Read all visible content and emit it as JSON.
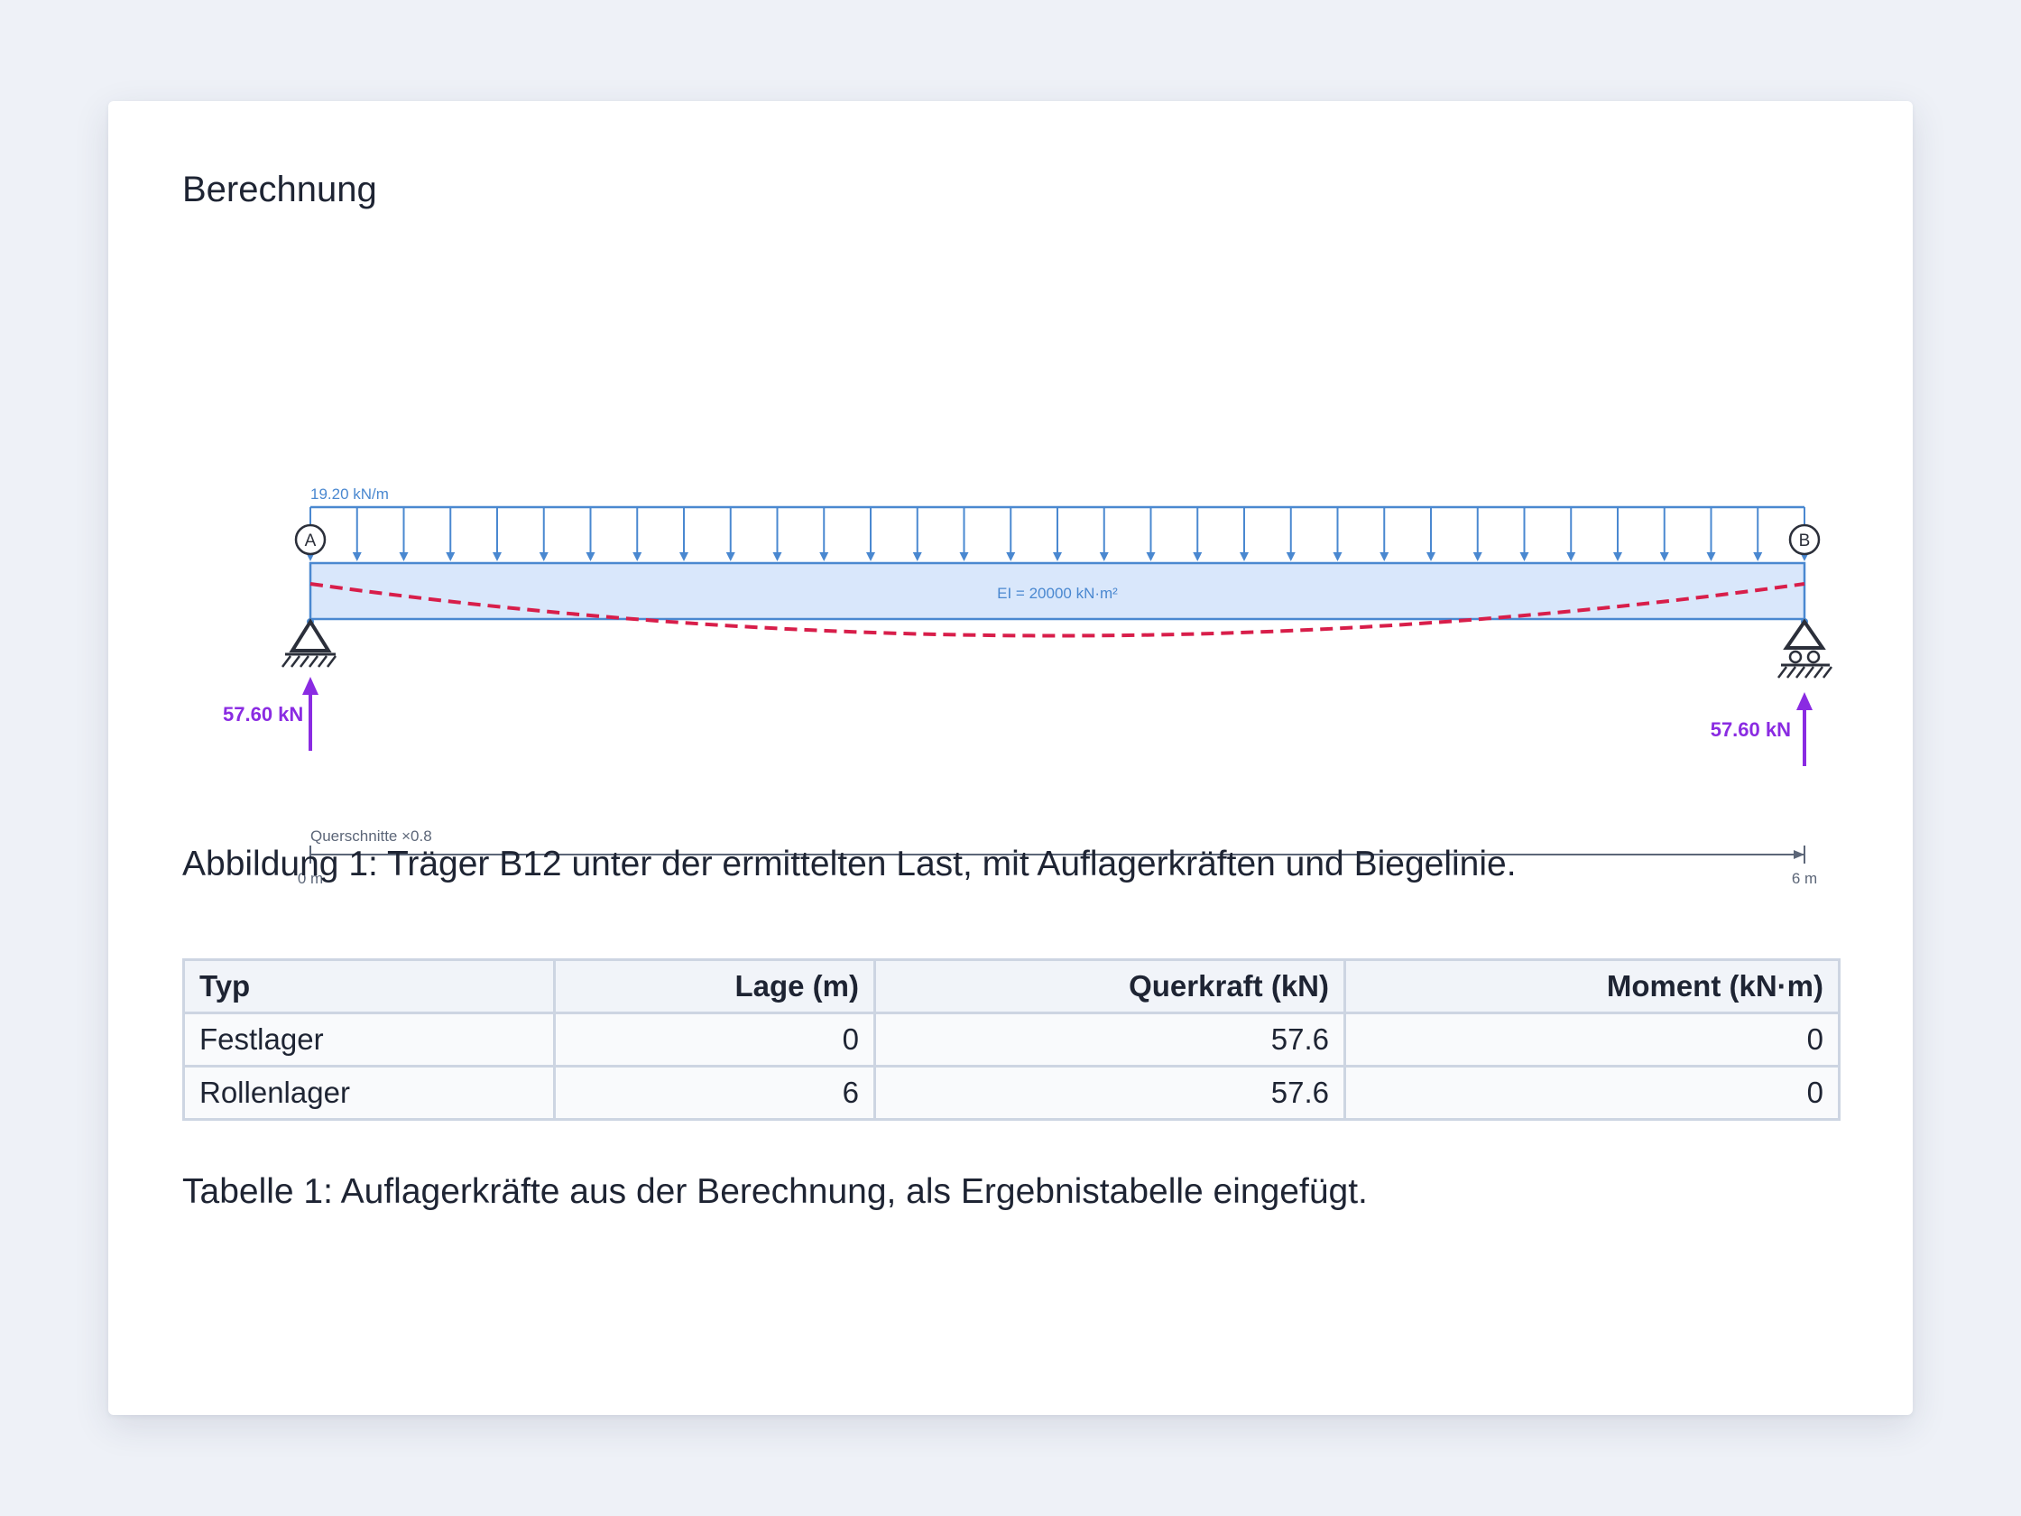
{
  "document": {
    "title": "Berechnung",
    "figure_caption": "Abbildung 1: Träger B12 unter der ermittelten Last, mit Auflagerkräften und Biegelinie.",
    "table_caption": "Tabelle 1: Auflagerkräfte aus der Berechnung, als Ergebnistabelle eingefügt."
  },
  "diagram": {
    "load_label": "19.20 kN/m",
    "beam_label": "EI = 20000 kN·m²",
    "support_a_label": "A",
    "support_b_label": "B",
    "reaction_a_label": "57.60 kN",
    "reaction_b_label": "57.60 kN",
    "scale_label": "Querschnitte ×0.8",
    "axis_start_label": "0 m",
    "axis_end_label": "6 m",
    "span_m": 6,
    "colors": {
      "load": "#4a88d0",
      "beam_fill": "#d9e7fb",
      "deflection": "#d81e4a",
      "reaction": "#8a2be2",
      "support": "#2b2f3a",
      "axis": "#5c6678"
    }
  },
  "table": {
    "headers": [
      "Typ",
      "Lage (m)",
      "Querkraft (kN)",
      "Moment (kN·m)"
    ],
    "rows": [
      [
        "Festlager",
        "0",
        "57.6",
        "0"
      ],
      [
        "Rollenlager",
        "6",
        "57.6",
        "0"
      ]
    ]
  }
}
